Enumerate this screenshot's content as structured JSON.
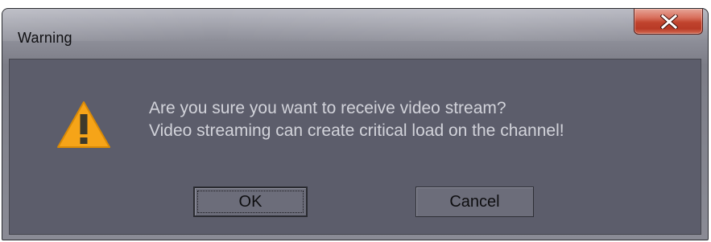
{
  "window": {
    "title": "Warning",
    "close_icon": "close-icon"
  },
  "dialog": {
    "icon": "warning-icon",
    "message_line1": "Are you sure you want to receive video stream?",
    "message_line2": "Video streaming can create critical load on the channel!"
  },
  "buttons": {
    "ok_label": "OK",
    "cancel_label": "Cancel"
  },
  "colors": {
    "client_background": "#5c5d6b",
    "message_text": "#d2d3da",
    "warning_fill": "#f6a418",
    "close_button": "#c0432d"
  }
}
